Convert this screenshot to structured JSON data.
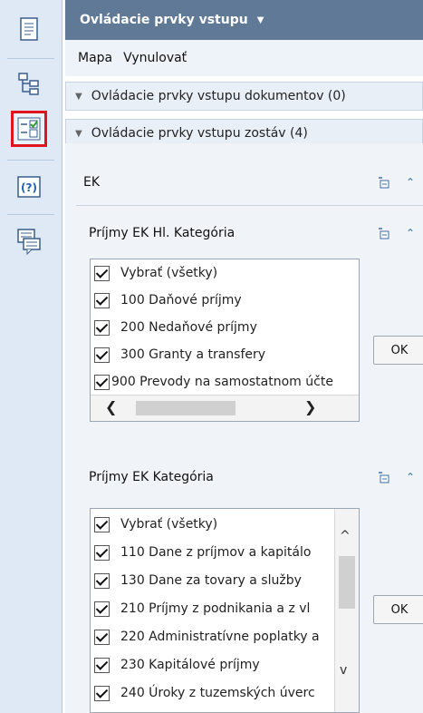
{
  "header": {
    "title": "Ovládacie prvky vstupu"
  },
  "menu": {
    "items": [
      "Mapa",
      "Vynulovať"
    ]
  },
  "accordions": [
    {
      "label": "Ovládacie prvky vstupu dokumentov (0)"
    },
    {
      "label": "Ovládacie prvky vstupu zostáv (4)"
    }
  ],
  "section": {
    "label": "EK"
  },
  "filters": [
    {
      "title": "Príjmy EK Hl. Kategória",
      "ok_label": "OK",
      "items": [
        "Vybrať (všetky)",
        "100 Daňové príjmy",
        "200 Nedaňové príjmy",
        "300 Granty a transfery",
        "900 Prevody na samostatnom účte"
      ]
    },
    {
      "title": "Príjmy EK Kategória",
      "ok_label": "OK",
      "items": [
        "Vybrať (všetky)",
        "110 Dane z príjmov a kapitálo",
        "130 Dane za tovary a služby",
        "210 Príjmy z podnikania a z vl",
        "220 Administratívne poplatky a",
        "230 Kapitálové príjmy",
        "240 Úroky z tuzemských úverc"
      ]
    }
  ],
  "icons": {
    "rail": [
      "document-icon",
      "tree-icon",
      "controls-icon",
      "help-icon",
      "comment-icon"
    ]
  },
  "colors": {
    "header_bg": "#5f7996",
    "rail_bg": "#dfe9f6",
    "highlight": "#e0141e"
  }
}
